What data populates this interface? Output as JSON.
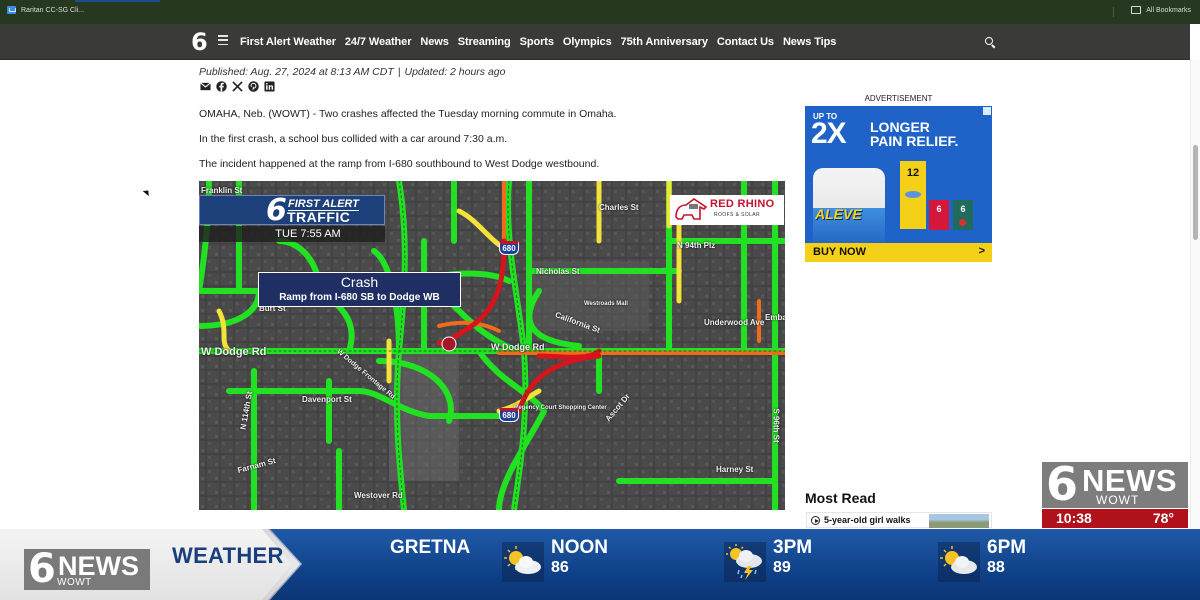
{
  "browser": {
    "bookmarks_left": "Raritan CC-SG Cli...",
    "bookmarks_right": "All Bookmarks"
  },
  "nav": {
    "logo": "6",
    "menu_icon": "hamburger-icon",
    "links": [
      "First Alert Weather",
      "24/7 Weather",
      "News",
      "Streaming",
      "Sports",
      "Olympics",
      "75th Anniversary",
      "Contact Us",
      "News Tips"
    ],
    "search_icon": "search-icon"
  },
  "article": {
    "published": "Published: Aug. 27, 2024 at 8:13 AM CDT",
    "separator": "|",
    "updated": "Updated: 2 hours ago",
    "share_icons": [
      "email-icon",
      "facebook-icon",
      "x-icon",
      "pinterest-icon",
      "linkedin-icon"
    ],
    "paragraphs": [
      "OMAHA, Neb. (WOWT) - Two crashes affected the Tuesday morning commute in Omaha.",
      "In the first crash, a school bus collided with a car around 7:30 a.m.",
      "The incident happened at the ramp from I-680 southbound to West Dodge westbound."
    ]
  },
  "map": {
    "brand_number": "6",
    "brand_line1": "FIRST ALERT",
    "brand_line2": "TRAFFIC",
    "time": "TUE 7:55 AM",
    "crash_title": "Crash",
    "crash_subtitle": "Ramp from I-680 SB to Dodge WB",
    "sponsor_name": "RED RHINO",
    "sponsor_sub": "ROOFS & SOLAR",
    "highway_shield": "680",
    "street_labels": {
      "franklin": "Franklin St",
      "charles": "Charles St",
      "n94": "N 94th Plz",
      "nicholas": "Nicholas St",
      "westroads": "Westroads Mall",
      "burt": "Burt St",
      "california": "California St",
      "underwood": "Underwood Ave",
      "embassy": "Emba",
      "wdodge_left": "W Dodge Rd",
      "wdodge_mid": "W Dodge Rd",
      "frontage": "W Dodge Frontage Rd",
      "davenport": "Davenport St",
      "regency": "Regency Court Shopping Center",
      "ascot": "Ascot Dr",
      "farnam": "Farnam St",
      "harney": "Harney St",
      "westover": "Westover Rd",
      "s96": "S 96th St",
      "n114": "N 114th St"
    }
  },
  "sidebar": {
    "ad_label": "ADVERTISEMENT",
    "ad": {
      "up_to": "UP TO",
      "headline_big": "2X",
      "headline_1": "LONGER",
      "headline_2": "PAIN RELIEF.",
      "brand": "ALEVE",
      "bar_1": "12",
      "bar_2": "6",
      "bar_3": "6",
      "cta": "BUY NOW",
      "cta_arrow": ">"
    },
    "most_read_title": "Most Read",
    "most_read_items": [
      {
        "title": "5-year-old girl walks"
      }
    ]
  },
  "overlay": {
    "bug_number": "6",
    "bug_news": "NEWS",
    "bug_station": "WOWT",
    "clock_time": "10:38",
    "clock_temp": "78°"
  },
  "weather_bar": {
    "logo_number": "6",
    "logo_news": "NEWS",
    "logo_station": "WOWT",
    "title": "WEATHER",
    "city": "GRETNA",
    "forecast": [
      {
        "label": "NOON",
        "temp": "86",
        "icon": "partly-cloudy-icon"
      },
      {
        "label": "3PM",
        "temp": "89",
        "icon": "thunderstorm-sun-icon"
      },
      {
        "label": "6PM",
        "temp": "88",
        "icon": "partly-cloudy-icon"
      }
    ]
  },
  "colors": {
    "nav_bg": "#3a3a39",
    "traffic_green": "#22e022",
    "traffic_yellow": "#f2e23a",
    "traffic_orange": "#f26a1b",
    "traffic_red": "#d5141b",
    "weather_blue": "#0e3e83",
    "clock_red": "#b0111b"
  }
}
